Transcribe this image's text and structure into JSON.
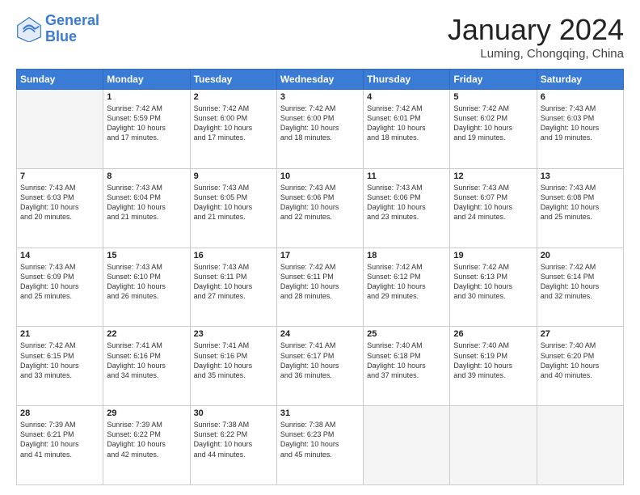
{
  "header": {
    "logo_text_general": "General",
    "logo_text_blue": "Blue",
    "month_title": "January 2024",
    "location": "Luming, Chongqing, China"
  },
  "weekdays": [
    "Sunday",
    "Monday",
    "Tuesday",
    "Wednesday",
    "Thursday",
    "Friday",
    "Saturday"
  ],
  "weeks": [
    [
      {
        "day": "",
        "empty": true,
        "content": ""
      },
      {
        "day": "1",
        "content": "Sunrise: 7:42 AM\nSunset: 5:59 PM\nDaylight: 10 hours\nand 17 minutes."
      },
      {
        "day": "2",
        "content": "Sunrise: 7:42 AM\nSunset: 6:00 PM\nDaylight: 10 hours\nand 17 minutes."
      },
      {
        "day": "3",
        "content": "Sunrise: 7:42 AM\nSunset: 6:00 PM\nDaylight: 10 hours\nand 18 minutes."
      },
      {
        "day": "4",
        "content": "Sunrise: 7:42 AM\nSunset: 6:01 PM\nDaylight: 10 hours\nand 18 minutes."
      },
      {
        "day": "5",
        "content": "Sunrise: 7:42 AM\nSunset: 6:02 PM\nDaylight: 10 hours\nand 19 minutes."
      },
      {
        "day": "6",
        "content": "Sunrise: 7:43 AM\nSunset: 6:03 PM\nDaylight: 10 hours\nand 19 minutes."
      }
    ],
    [
      {
        "day": "7",
        "content": "Sunrise: 7:43 AM\nSunset: 6:03 PM\nDaylight: 10 hours\nand 20 minutes."
      },
      {
        "day": "8",
        "content": "Sunrise: 7:43 AM\nSunset: 6:04 PM\nDaylight: 10 hours\nand 21 minutes."
      },
      {
        "day": "9",
        "content": "Sunrise: 7:43 AM\nSunset: 6:05 PM\nDaylight: 10 hours\nand 21 minutes."
      },
      {
        "day": "10",
        "content": "Sunrise: 7:43 AM\nSunset: 6:06 PM\nDaylight: 10 hours\nand 22 minutes."
      },
      {
        "day": "11",
        "content": "Sunrise: 7:43 AM\nSunset: 6:06 PM\nDaylight: 10 hours\nand 23 minutes."
      },
      {
        "day": "12",
        "content": "Sunrise: 7:43 AM\nSunset: 6:07 PM\nDaylight: 10 hours\nand 24 minutes."
      },
      {
        "day": "13",
        "content": "Sunrise: 7:43 AM\nSunset: 6:08 PM\nDaylight: 10 hours\nand 25 minutes."
      }
    ],
    [
      {
        "day": "14",
        "content": "Sunrise: 7:43 AM\nSunset: 6:09 PM\nDaylight: 10 hours\nand 25 minutes."
      },
      {
        "day": "15",
        "content": "Sunrise: 7:43 AM\nSunset: 6:10 PM\nDaylight: 10 hours\nand 26 minutes."
      },
      {
        "day": "16",
        "content": "Sunrise: 7:43 AM\nSunset: 6:11 PM\nDaylight: 10 hours\nand 27 minutes."
      },
      {
        "day": "17",
        "content": "Sunrise: 7:42 AM\nSunset: 6:11 PM\nDaylight: 10 hours\nand 28 minutes."
      },
      {
        "day": "18",
        "content": "Sunrise: 7:42 AM\nSunset: 6:12 PM\nDaylight: 10 hours\nand 29 minutes."
      },
      {
        "day": "19",
        "content": "Sunrise: 7:42 AM\nSunset: 6:13 PM\nDaylight: 10 hours\nand 30 minutes."
      },
      {
        "day": "20",
        "content": "Sunrise: 7:42 AM\nSunset: 6:14 PM\nDaylight: 10 hours\nand 32 minutes."
      }
    ],
    [
      {
        "day": "21",
        "content": "Sunrise: 7:42 AM\nSunset: 6:15 PM\nDaylight: 10 hours\nand 33 minutes."
      },
      {
        "day": "22",
        "content": "Sunrise: 7:41 AM\nSunset: 6:16 PM\nDaylight: 10 hours\nand 34 minutes."
      },
      {
        "day": "23",
        "content": "Sunrise: 7:41 AM\nSunset: 6:16 PM\nDaylight: 10 hours\nand 35 minutes."
      },
      {
        "day": "24",
        "content": "Sunrise: 7:41 AM\nSunset: 6:17 PM\nDaylight: 10 hours\nand 36 minutes."
      },
      {
        "day": "25",
        "content": "Sunrise: 7:40 AM\nSunset: 6:18 PM\nDaylight: 10 hours\nand 37 minutes."
      },
      {
        "day": "26",
        "content": "Sunrise: 7:40 AM\nSunset: 6:19 PM\nDaylight: 10 hours\nand 39 minutes."
      },
      {
        "day": "27",
        "content": "Sunrise: 7:40 AM\nSunset: 6:20 PM\nDaylight: 10 hours\nand 40 minutes."
      }
    ],
    [
      {
        "day": "28",
        "content": "Sunrise: 7:39 AM\nSunset: 6:21 PM\nDaylight: 10 hours\nand 41 minutes."
      },
      {
        "day": "29",
        "content": "Sunrise: 7:39 AM\nSunset: 6:22 PM\nDaylight: 10 hours\nand 42 minutes."
      },
      {
        "day": "30",
        "content": "Sunrise: 7:38 AM\nSunset: 6:22 PM\nDaylight: 10 hours\nand 44 minutes."
      },
      {
        "day": "31",
        "content": "Sunrise: 7:38 AM\nSunset: 6:23 PM\nDaylight: 10 hours\nand 45 minutes."
      },
      {
        "day": "",
        "empty": true,
        "content": ""
      },
      {
        "day": "",
        "empty": true,
        "content": ""
      },
      {
        "day": "",
        "empty": true,
        "content": ""
      }
    ]
  ]
}
